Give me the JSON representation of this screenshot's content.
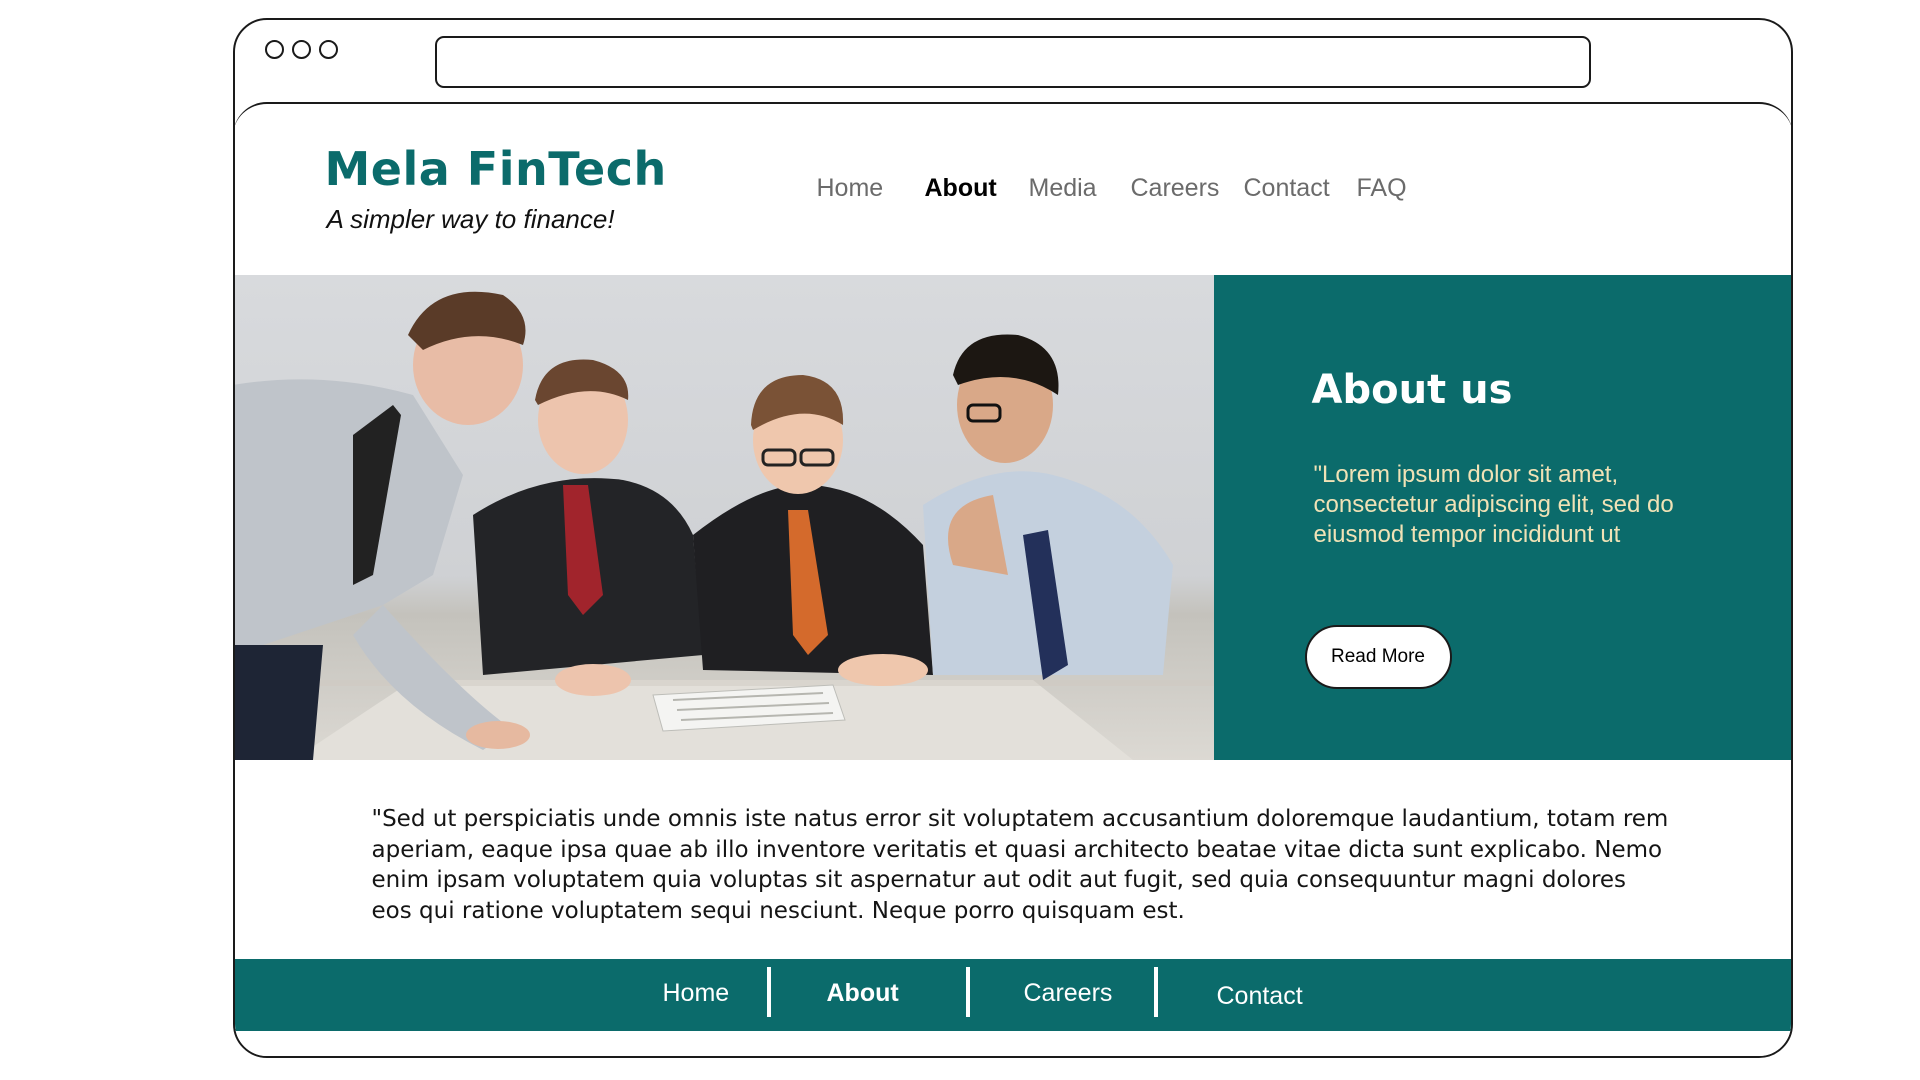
{
  "brand": {
    "name": "Mela FinTech",
    "tagline": "A simpler way to finance!"
  },
  "nav": {
    "items": [
      {
        "label": "Home",
        "active": false
      },
      {
        "label": "About",
        "active": true
      },
      {
        "label": "Media",
        "active": false
      },
      {
        "label": "Careers",
        "active": false
      },
      {
        "label": "Contact",
        "active": false
      },
      {
        "label": "FAQ",
        "active": false
      }
    ]
  },
  "hero": {
    "image_description": "four-businessmen-reviewing-document-photo",
    "title": "About us",
    "text": "\"Lorem ipsum dolor sit amet, consectetur adipiscing elit, sed do eiusmod tempor incididunt ut",
    "button_label": "Read More"
  },
  "body": {
    "text": "\"Sed ut perspiciatis unde omnis iste natus error sit voluptatem accusantium doloremque laudantium, totam rem aperiam, eaque ipsa quae ab illo inventore veritatis et quasi architecto beatae vitae dicta sunt explicabo. Nemo enim ipsam voluptatem quia voluptas sit aspernatur aut odit aut fugit, sed quia consequuntur magni dolores eos qui ratione voluptatem sequi nesciunt. Neque porro quisquam est."
  },
  "footer": {
    "items": [
      {
        "label": "Home",
        "active": false
      },
      {
        "label": "About",
        "active": true
      },
      {
        "label": "Careers",
        "active": false
      },
      {
        "label": "Contact",
        "active": false
      }
    ]
  },
  "colors": {
    "brand_teal": "#0b6b6b",
    "about_text": "#f0e2b6",
    "nav_inactive": "#6b6b6b",
    "frame_stroke": "#1a1a1a"
  }
}
